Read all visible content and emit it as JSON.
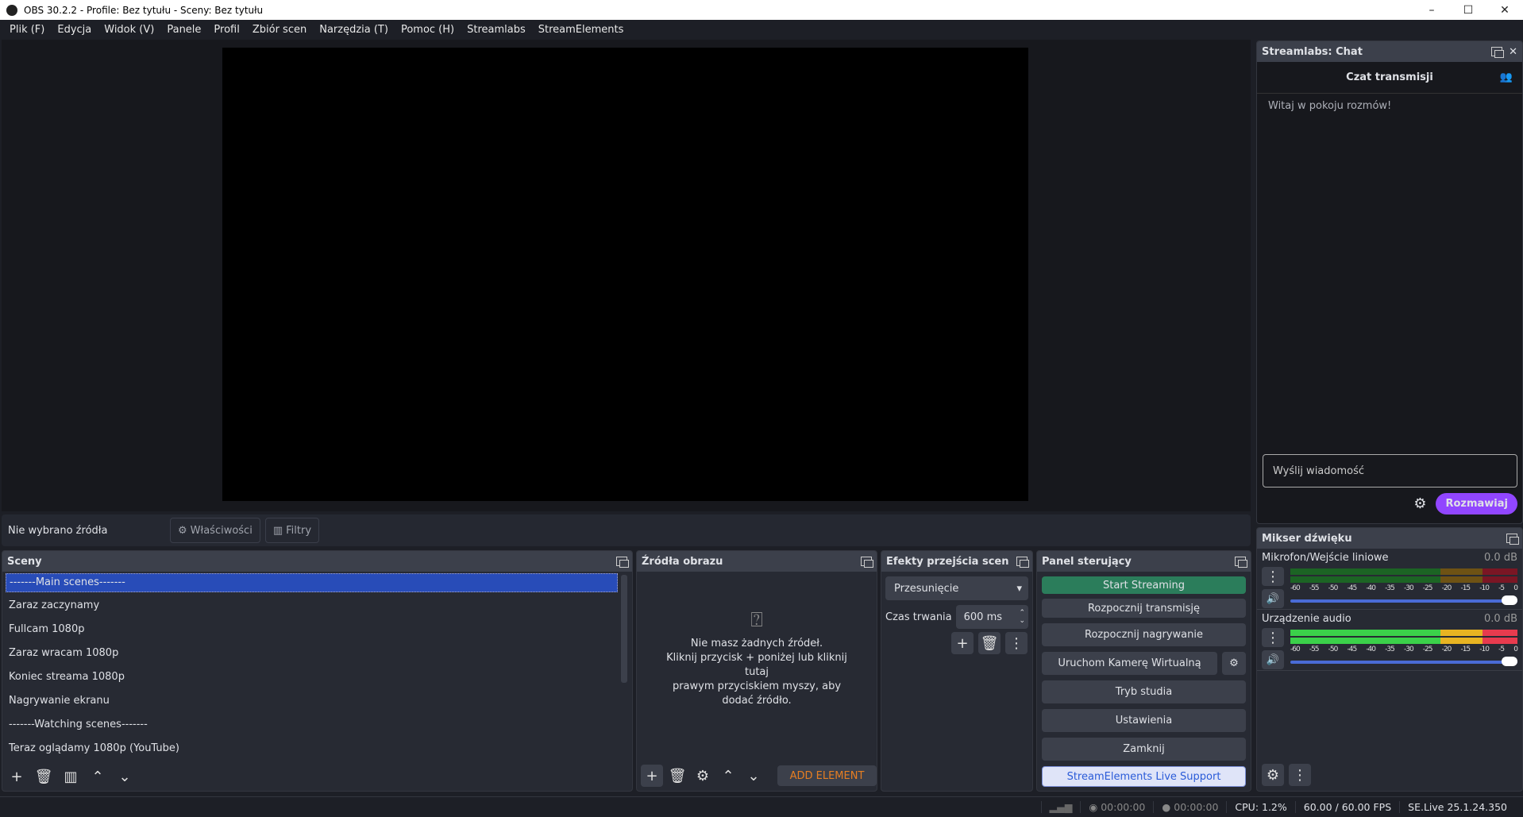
{
  "window": {
    "title": "OBS 30.2.2 - Profile: Bez tytułu - Sceny: Bez tytułu"
  },
  "menu": [
    "Plik (F)",
    "Edycja",
    "Widok (V)",
    "Panele",
    "Profil",
    "Zbiór scen",
    "Narzędzia (T)",
    "Pomoc (H)",
    "Streamlabs",
    "StreamElements"
  ],
  "source_bar": {
    "label": "Nie wybrano źródła",
    "properties": "Właściwości",
    "filters": "Filtry"
  },
  "scenes": {
    "title": "Sceny",
    "items": [
      "-------Main scenes-------",
      "Zaraz zaczynamy",
      "Fullcam 1080p",
      "Zaraz wracam 1080p",
      "Koniec streama 1080p",
      "Nagrywanie ekranu",
      "-------Watching scenes-------",
      "Teraz oglądamy 1080p (YouTube)"
    ],
    "selected": 0
  },
  "sources": {
    "title": "Źródła obrazu",
    "empty": [
      "Nie masz żadnych źródeł.",
      "Kliknij przycisk + poniżej lub kliknij",
      "tutaj",
      "prawym przyciskiem myszy, aby",
      "dodać źródło."
    ],
    "add_element": "ADD ELEMENT"
  },
  "transitions": {
    "title": "Efekty przejścia scen",
    "selected": "Przesunięcie",
    "duration_label": "Czas trwania",
    "duration": "600 ms"
  },
  "controls": {
    "title": "Panel sterujący",
    "buttons": [
      "Start Streaming",
      "Rozpocznij transmisję",
      "Rozpocznij nagrywanie",
      "Uruchom Kamerę Wirtualną",
      "Tryb studia",
      "Ustawienia",
      "Zamknij",
      "StreamElements Live Support"
    ]
  },
  "chat": {
    "dock_title": "Streamlabs: Chat",
    "header": "Czat transmisji",
    "welcome": "Witaj w pokoju rozmów!",
    "input_placeholder": "Wyślij wiadomość",
    "send": "Rozmawiaj"
  },
  "mixer": {
    "title": "Mikser dźwięku",
    "channels": [
      {
        "name": "Mikrofon/Wejście liniowe",
        "db": "0.0 dB",
        "volume": 1.0
      },
      {
        "name": "Urządzenie audio",
        "db": "0.0 dB",
        "volume": 1.0
      }
    ],
    "ticks": [
      "-60",
      "-55",
      "-50",
      "-45",
      "-40",
      "-35",
      "-30",
      "-25",
      "-20",
      "-15",
      "-10",
      "-5",
      "0"
    ]
  },
  "status": {
    "stream_time": "00:00:00",
    "rec_time": "00:00:00",
    "cpu": "CPU: 1.2%",
    "fps": "60.00 / 60.00 FPS",
    "version": "SE.Live 25.1.24.350"
  }
}
